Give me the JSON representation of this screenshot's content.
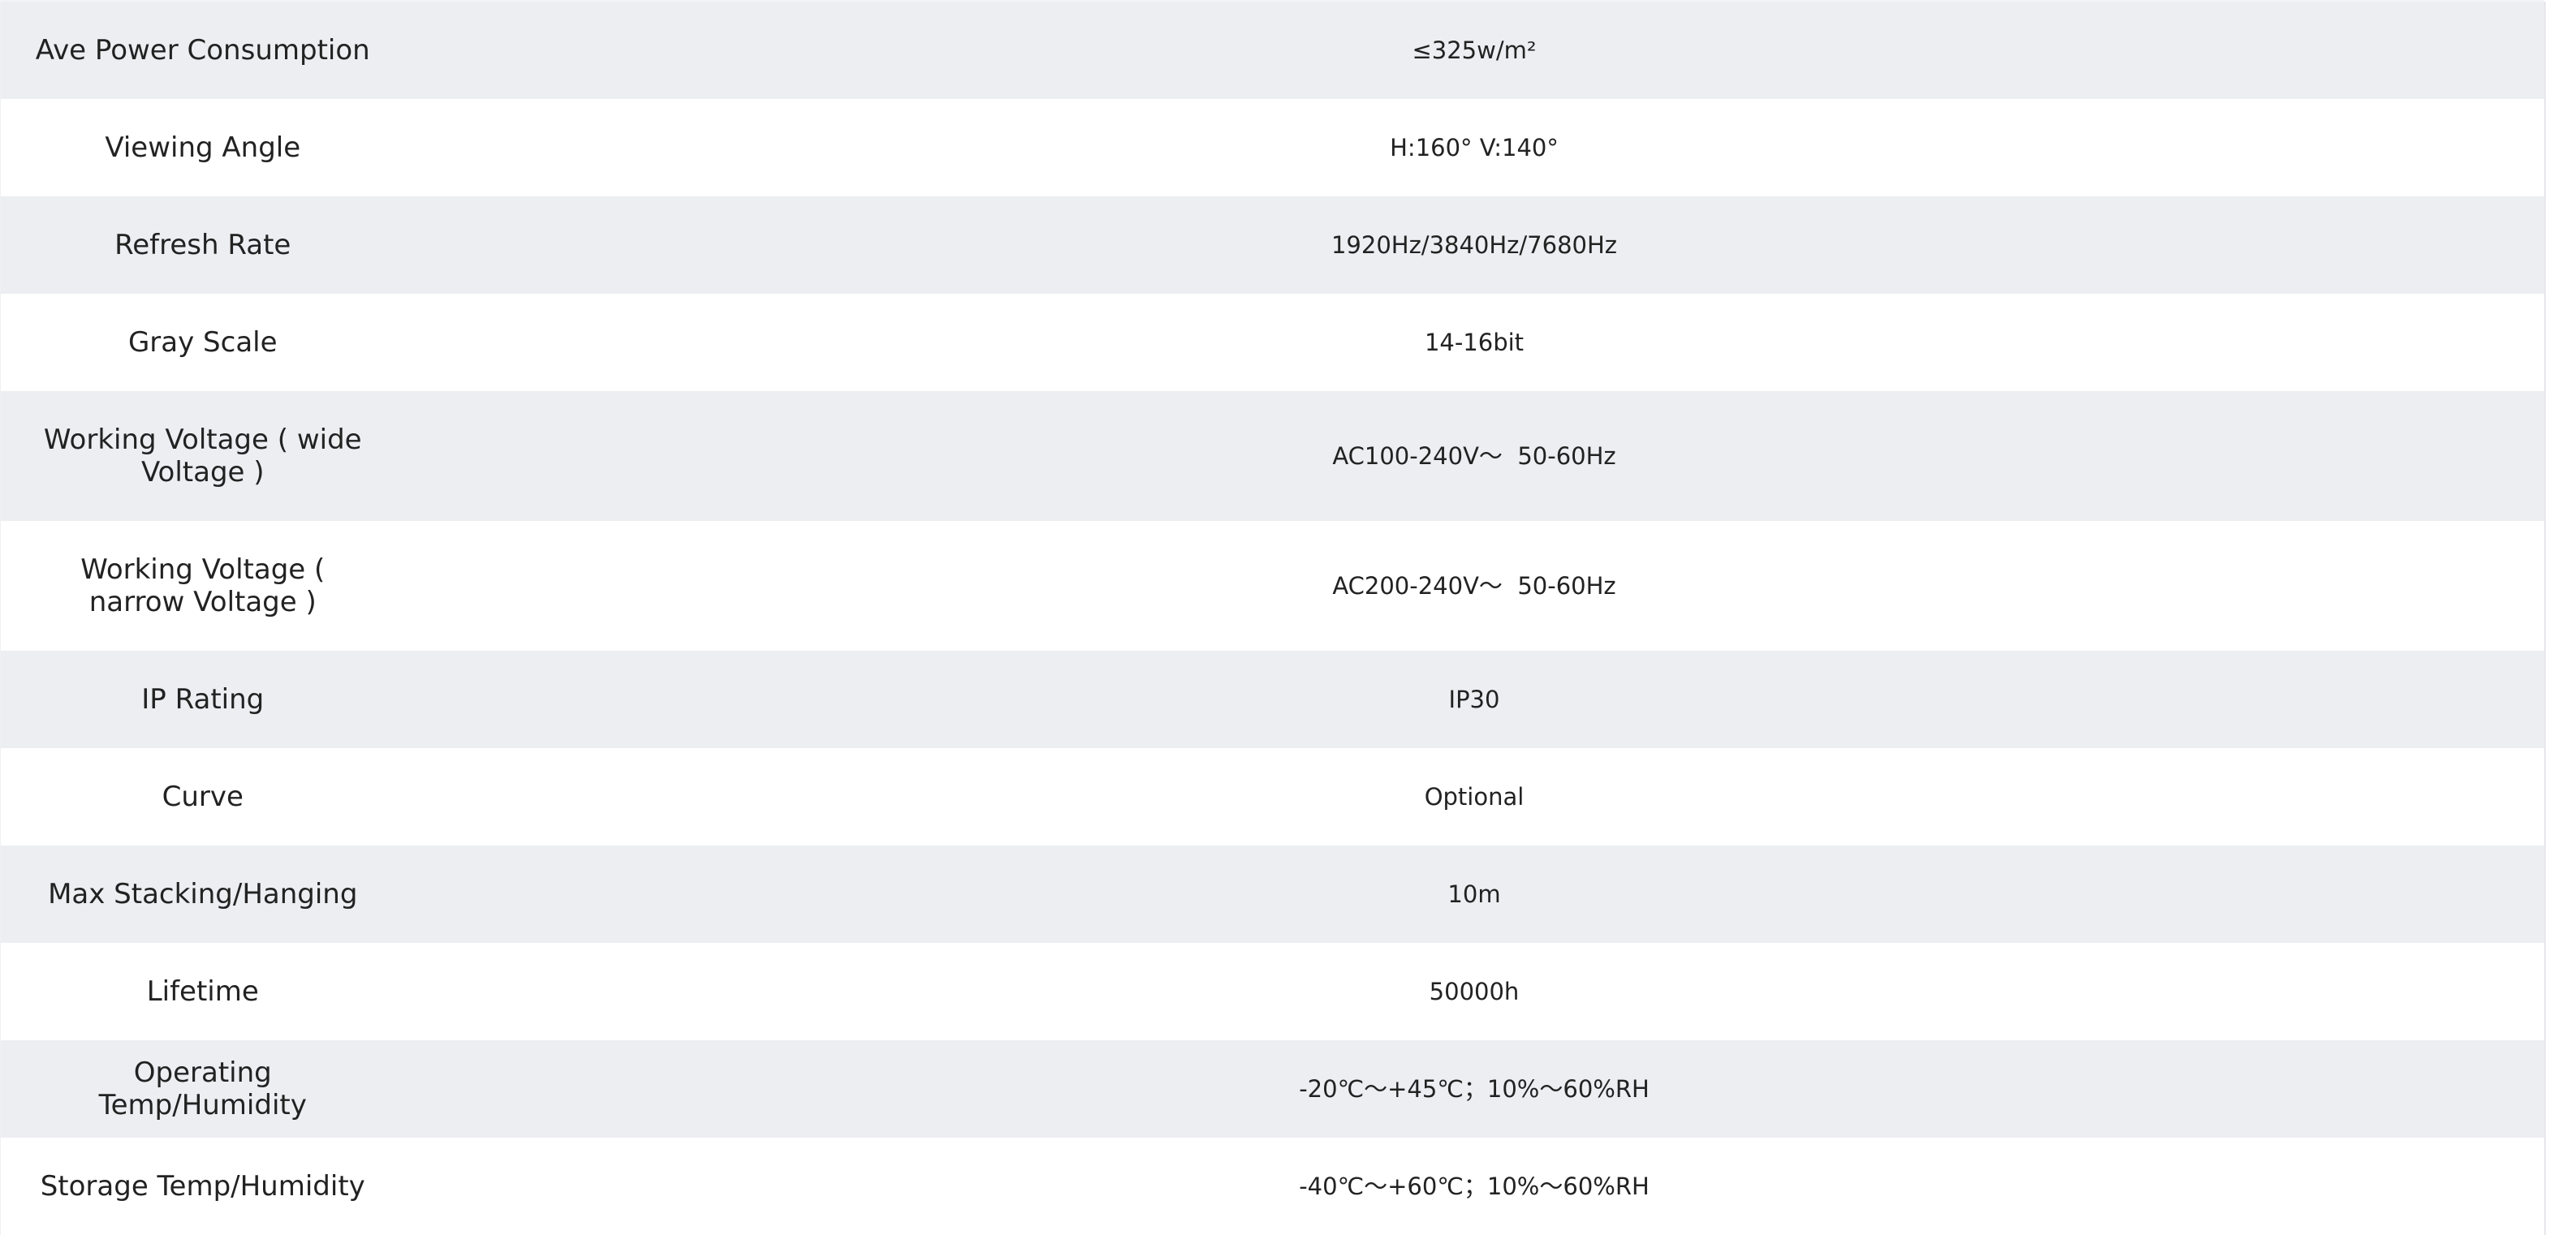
{
  "specs": [
    {
      "label": "Ave Power Consumption",
      "value": "≤325w/m²"
    },
    {
      "label": "Viewing Angle",
      "value": "H:160° V:140°"
    },
    {
      "label": "Refresh Rate",
      "value": "1920Hz/3840Hz/7680Hz"
    },
    {
      "label": "Gray Scale",
      "value": "14-16bit"
    },
    {
      "label": "Working Voltage ( wide Voltage )",
      "value": "AC100-240V～  50-60Hz"
    },
    {
      "label": "Working Voltage ( narrow Voltage )",
      "value": "AC200-240V～  50-60Hz"
    },
    {
      "label": "IP Rating",
      "value": "IP30"
    },
    {
      "label": "Curve",
      "value": "Optional"
    },
    {
      "label": "Max Stacking/Hanging",
      "value": "10m"
    },
    {
      "label": "Lifetime",
      "value": "50000h"
    },
    {
      "label": "Operating Temp/Humidity",
      "value": "-20℃～+45℃；10%～60%RH"
    },
    {
      "label": "Storage Temp/Humidity",
      "value": "-40℃～+60℃；10%～60%RH"
    }
  ]
}
